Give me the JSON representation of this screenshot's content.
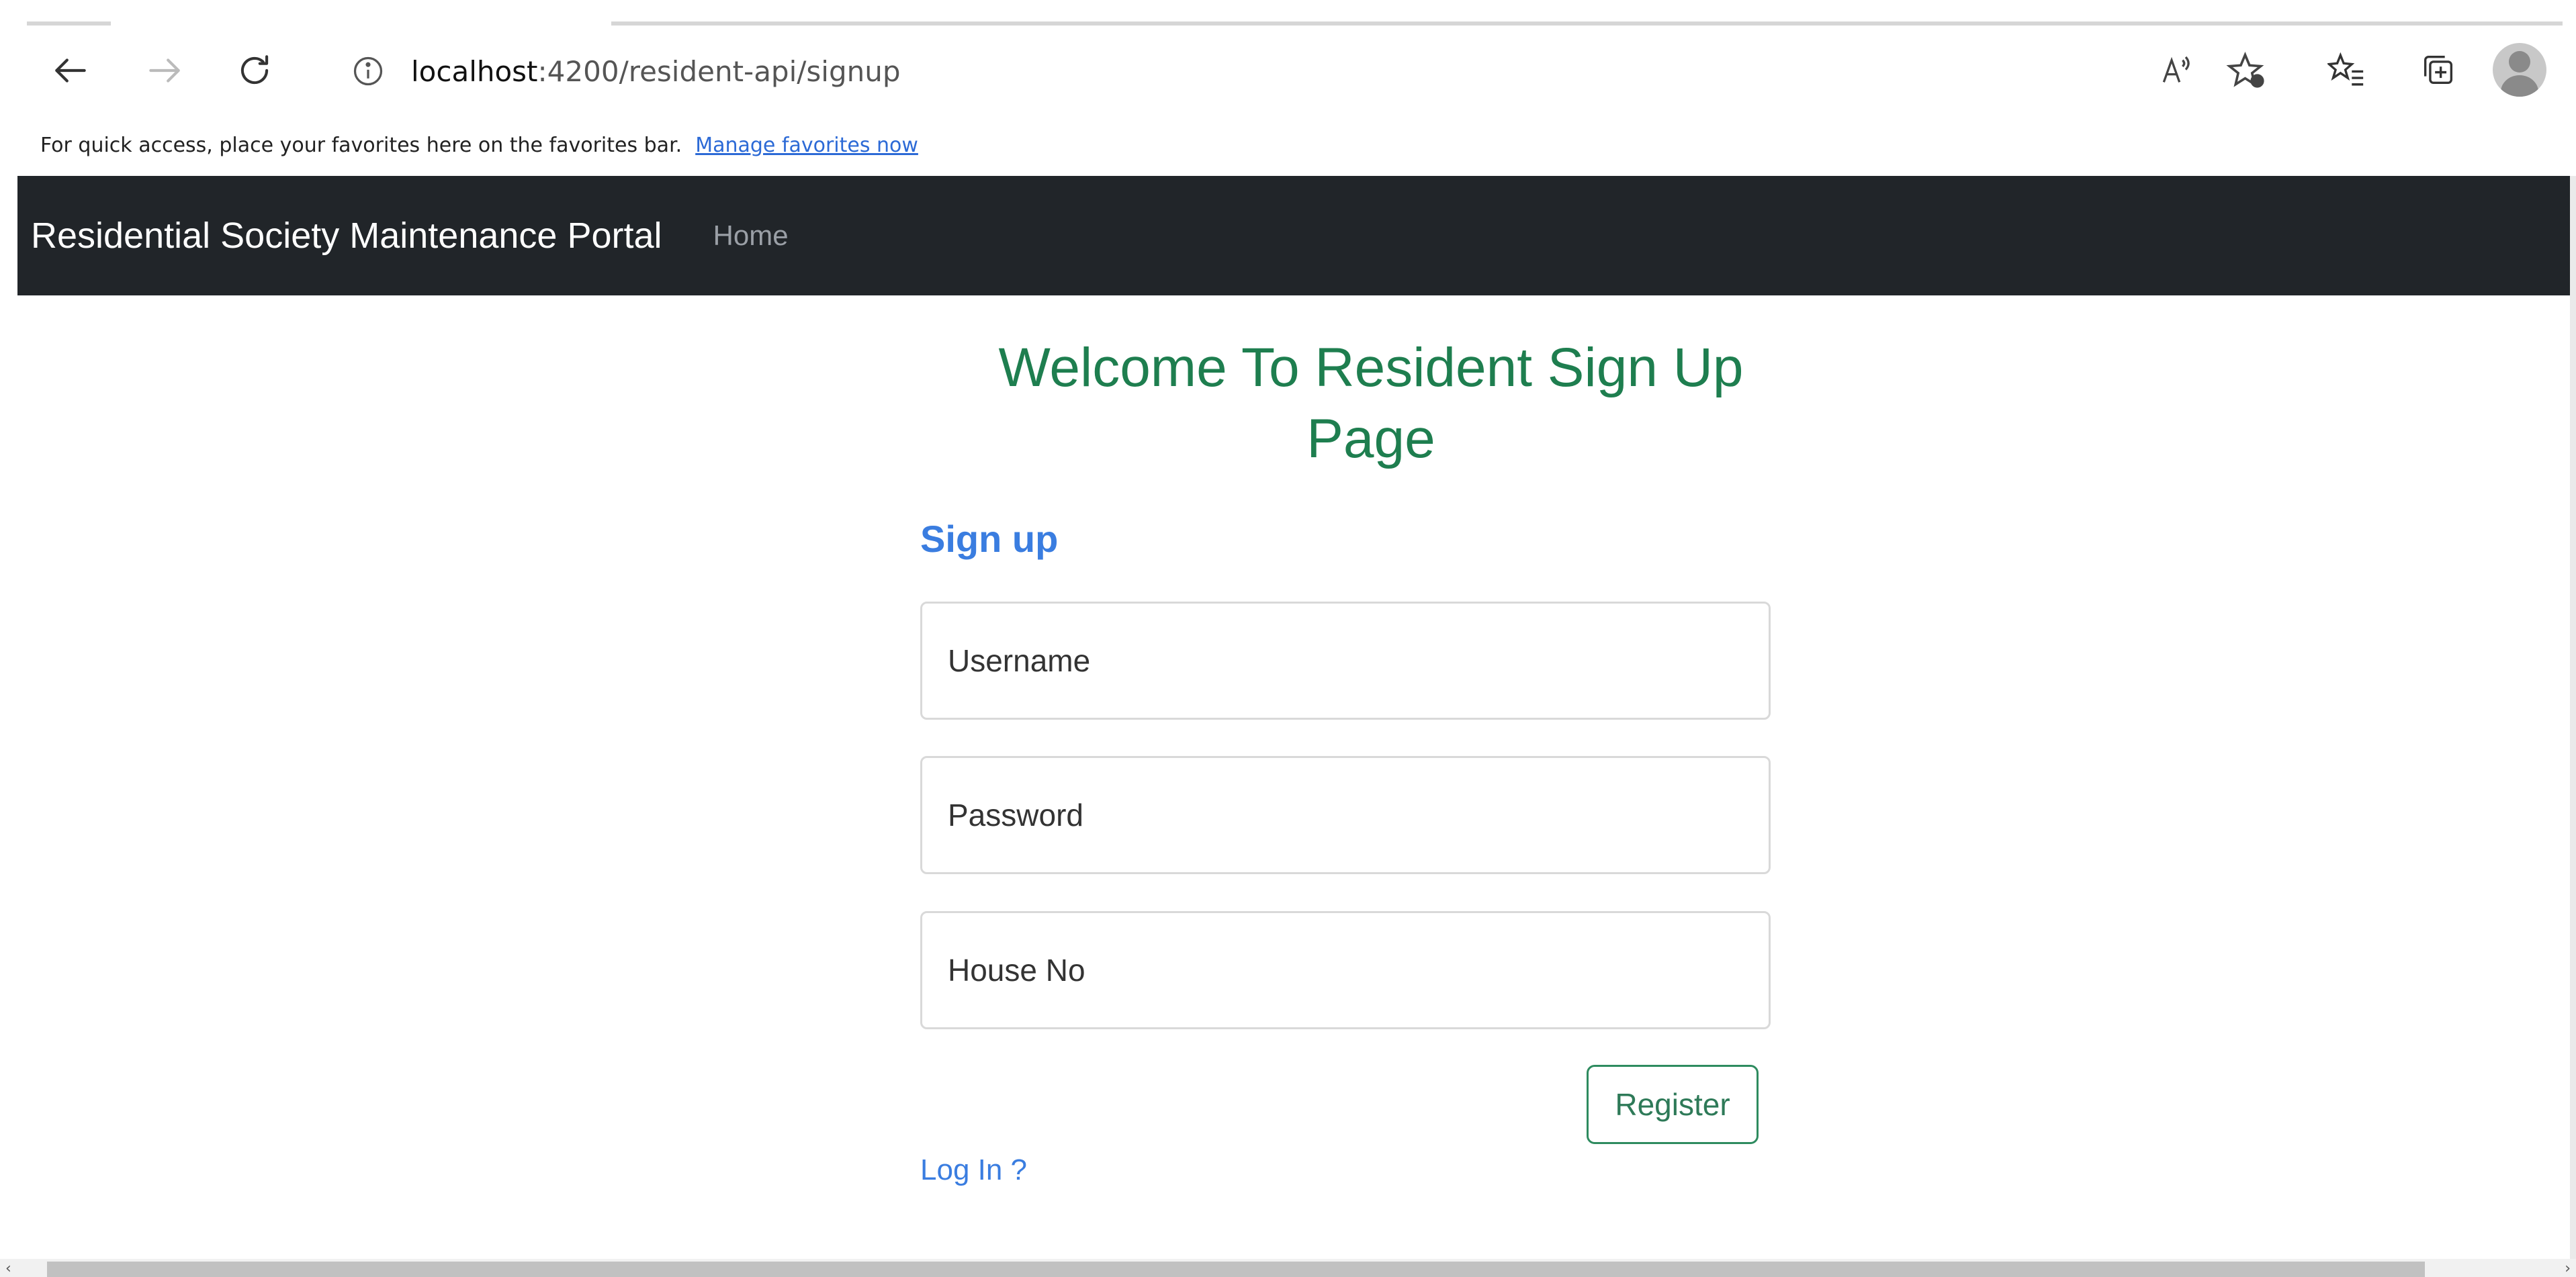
{
  "browser": {
    "url_host": "localhost",
    "url_rest": ":4200/resident-api/signup",
    "read_aloud_icon": "read-aloud-icon",
    "favorites_bar": {
      "message": "For quick access, place your favorites here on the favorites bar.",
      "link": "Manage favorites now"
    }
  },
  "navbar": {
    "brand": "Residential Society Maintenance Portal",
    "home": "Home"
  },
  "page": {
    "welcome_line1": "Welcome To Resident Sign Up",
    "welcome_line2": "Page",
    "signup_title": "Sign up",
    "fields": {
      "username_placeholder": "Username",
      "password_placeholder": "Password",
      "house_placeholder": "House No"
    },
    "register_label": "Register",
    "login_link": "Log In ?"
  },
  "colors": {
    "navbar_bg": "#212529",
    "heading_green": "#1e7e4f",
    "link_blue": "#3a7de0",
    "button_border": "#2e8b5f"
  }
}
